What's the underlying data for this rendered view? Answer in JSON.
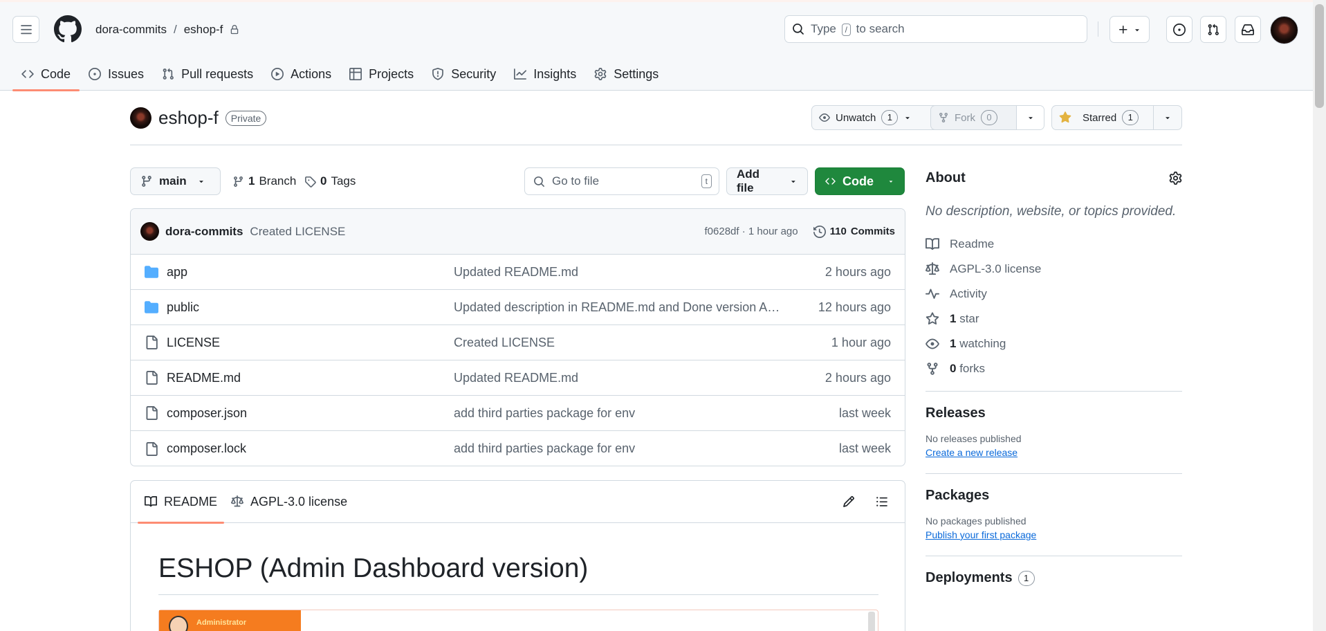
{
  "header": {
    "owner": "dora-commits",
    "separator": "/",
    "repo": "eshop-f",
    "search_prefix": "Type",
    "search_key": "/",
    "search_suffix": "to search"
  },
  "tabs": [
    {
      "label": "Code",
      "icon": "code-icon",
      "active": true
    },
    {
      "label": "Issues",
      "icon": "issue-icon"
    },
    {
      "label": "Pull requests",
      "icon": "pull-request-icon"
    },
    {
      "label": "Actions",
      "icon": "play-icon"
    },
    {
      "label": "Projects",
      "icon": "table-icon"
    },
    {
      "label": "Security",
      "icon": "shield-icon"
    },
    {
      "label": "Insights",
      "icon": "graph-icon"
    },
    {
      "label": "Settings",
      "icon": "gear-icon"
    }
  ],
  "repo_head": {
    "name": "eshop-f",
    "visibility": "Private",
    "unwatch_label": "Unwatch",
    "watch_count": "1",
    "fork_label": "Fork",
    "fork_count": "0",
    "starred_label": "Starred",
    "star_count": "1"
  },
  "toolbar": {
    "branch": "main",
    "branches_count": "1",
    "branches_label": "Branch",
    "tags_count": "0",
    "tags_label": "Tags",
    "goto_placeholder": "Go to file",
    "goto_key": "t",
    "add_file": "Add file",
    "code": "Code"
  },
  "latest_commit": {
    "author": "dora-commits",
    "message": "Created LICENSE",
    "sha_time": "f0628df · 1 hour ago",
    "commits_count": "110",
    "commits_label": "Commits"
  },
  "files": [
    {
      "name": "app",
      "type": "folder",
      "message": "Updated README.md",
      "time": "2 hours ago"
    },
    {
      "name": "public",
      "type": "folder",
      "message": "Updated description in README.md and Done version Admi...",
      "time": "12 hours ago"
    },
    {
      "name": "LICENSE",
      "type": "file",
      "message": "Created LICENSE",
      "time": "1 hour ago"
    },
    {
      "name": "README.md",
      "type": "file",
      "message": "Updated README.md",
      "time": "2 hours ago"
    },
    {
      "name": "composer.json",
      "type": "file",
      "message": "add third parties package for env",
      "time": "last week"
    },
    {
      "name": "composer.lock",
      "type": "file",
      "message": "add third parties package for env",
      "time": "last week"
    }
  ],
  "readme": {
    "tab_readme": "README",
    "tab_license": "AGPL-3.0 license",
    "title": "ESHOP (Admin Dashboard version)",
    "image_label": "Administrator"
  },
  "about": {
    "title": "About",
    "description": "No description, website, or topics provided.",
    "readme": "Readme",
    "license": "AGPL-3.0 license",
    "activity": "Activity",
    "stars_count": "1",
    "stars_label": "star",
    "watching_count": "1",
    "watching_label": "watching",
    "forks_count": "0",
    "forks_label": "forks"
  },
  "releases": {
    "title": "Releases",
    "empty": "No releases published",
    "link": "Create a new release"
  },
  "packages": {
    "title": "Packages",
    "empty": "No packages published",
    "link": "Publish your first package"
  },
  "deployments": {
    "title": "Deployments",
    "count": "1"
  },
  "colors": {
    "accent_tab": "#fd8c73",
    "code_button": "#1f883d",
    "folder": "#54aeff",
    "link": "#0969da"
  }
}
